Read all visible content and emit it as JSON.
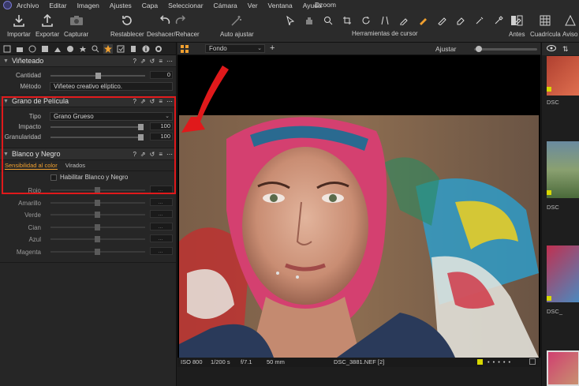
{
  "menubar": {
    "items": [
      "Archivo",
      "Editar",
      "Imagen",
      "Ajustes",
      "Capa",
      "Seleccionar",
      "Cámara",
      "Ver",
      "Ventana",
      "Ayuda"
    ],
    "app_name": "Dzoom"
  },
  "toolbar": {
    "importar": "Importar",
    "exportar": "Exportar",
    "capturar": "Capturar",
    "restablecer": "Restablecer",
    "deshacer": "Deshacer/Rehacer",
    "auto_ajustar": "Auto ajustar",
    "cursor_tools_label": "Herramientas de cursor",
    "antes": "Antes",
    "cuadricula": "Cuadrícula",
    "aviso": "Aviso"
  },
  "vineteado": {
    "title": "Viñeteado",
    "cantidad_label": "Cantidad",
    "cantidad_value": "0",
    "cantidad_level": 0.5,
    "metodo_label": "Método",
    "metodo_value": "Viñeteo creativo elíptico."
  },
  "grano": {
    "title": "Grano de Película",
    "tipo_label": "Tipo",
    "tipo_value": "Grano Grueso",
    "impacto_label": "Impacto",
    "impacto_value": "100",
    "impacto_level": 1.0,
    "granularidad_label": "Granularidad",
    "granularidad_value": "100",
    "granularidad_level": 1.0
  },
  "bw": {
    "title": "Blanco y Negro",
    "tab_sensibilidad": "Sensibilidad al color",
    "tab_virados": "Virados",
    "habilitar_label": "Habilitar Blanco y Negro",
    "channels": [
      {
        "label": "Rojo",
        "value": "..."
      },
      {
        "label": "Amarillo",
        "value": "..."
      },
      {
        "label": "Verde",
        "value": "..."
      },
      {
        "label": "Cian",
        "value": "..."
      },
      {
        "label": "Azul",
        "value": "..."
      },
      {
        "label": "Magenta",
        "value": "..."
      }
    ]
  },
  "viewer_bar": {
    "fondo": "Fondo",
    "ajustar": "Ajustar"
  },
  "info": {
    "iso": "ISO 800",
    "shutter": "1/200 s",
    "aperture": "f/7.1",
    "focal": "50 mm",
    "filename": "DSC_3881.NEF [2]"
  },
  "filmstrip": {
    "labels": [
      "DSC",
      "DSC_",
      "DSC_"
    ]
  },
  "colors": {
    "highlight": "#e0191b",
    "accent": "#f0a030",
    "color_tag": "#d8d800"
  }
}
